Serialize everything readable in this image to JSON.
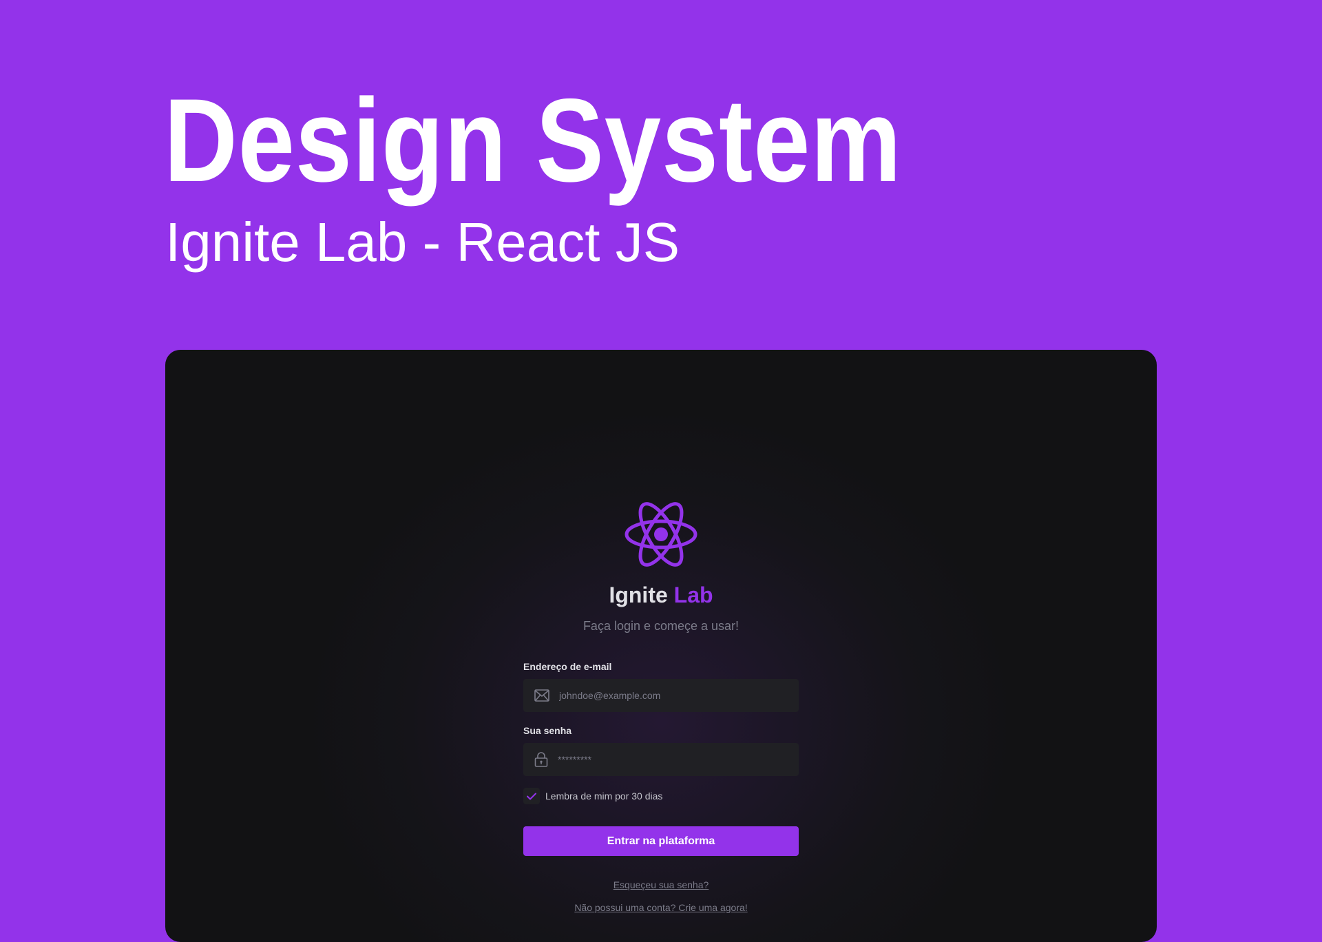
{
  "hero": {
    "title": "Design System",
    "subtitle": "Ignite Lab - React JS"
  },
  "login": {
    "logo_icon": "react-atom-icon",
    "brand_prefix": "Ignite",
    "brand_suffix": "Lab",
    "tagline": "Faça login e começe a usar!",
    "email": {
      "label": "Endereço de e-mail",
      "placeholder": "johndoe@example.com",
      "value": "",
      "icon": "envelope-icon"
    },
    "password": {
      "label": "Sua senha",
      "placeholder": "*********",
      "value": "",
      "icon": "lock-icon"
    },
    "remember": {
      "label": "Lembra de mim por 30 dias",
      "checked": true,
      "icon": "check-icon"
    },
    "submit_label": "Entrar na plataforma",
    "forgot_link": "Esqueçeu sua senha?",
    "signup_link": "Não possui uma conta? Crie uma agora!"
  },
  "colors": {
    "page_background": "#9333EA",
    "accent": "#9333EA",
    "panel_background": "#121214",
    "input_background": "#202024",
    "text_primary": "#E1E1E6",
    "text_muted": "#7C7C8A"
  }
}
